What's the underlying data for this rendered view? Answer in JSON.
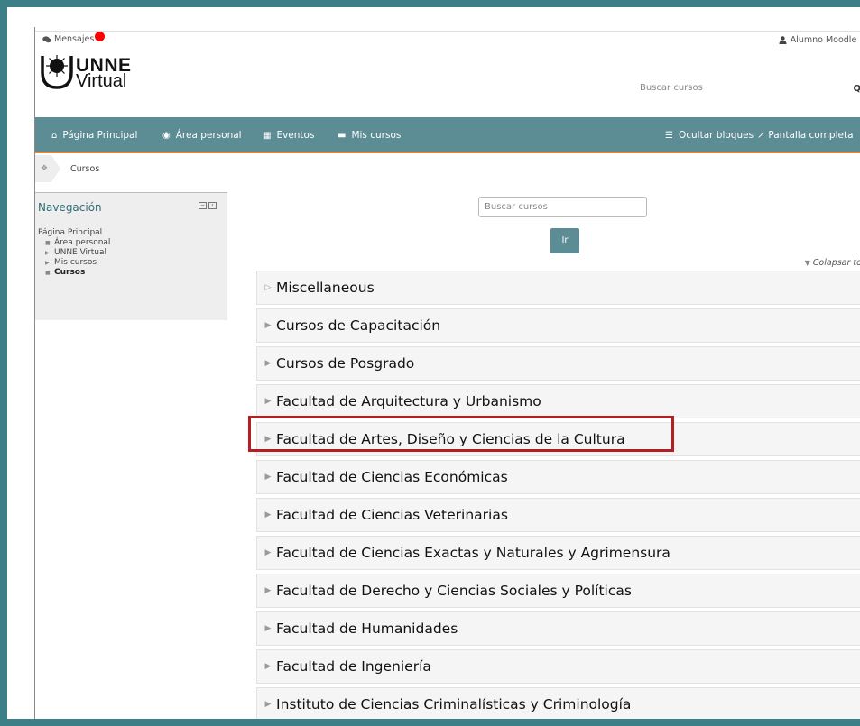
{
  "topbar": {
    "messages_label": "Mensajes",
    "user_label": "Alumno Moodle"
  },
  "logo": {
    "line1": "UNNE",
    "line2": "Virtual"
  },
  "top_search": {
    "placeholder": "Buscar cursos",
    "icon": "search-icon"
  },
  "navbar": {
    "items": [
      {
        "label": "Página Principal",
        "icon": "home-icon"
      },
      {
        "label": "Área personal",
        "icon": "dashboard-icon"
      },
      {
        "label": "Eventos",
        "icon": "calendar-icon"
      },
      {
        "label": "Mis cursos",
        "icon": "briefcase-icon"
      }
    ],
    "hide_blocks": "Ocultar bloques",
    "fullscreen": "Pantalla completa"
  },
  "breadcrumb": {
    "current": "Cursos"
  },
  "nav_block": {
    "title": "Navegación",
    "items": [
      {
        "label": "Página Principal"
      },
      {
        "label": "Área personal"
      },
      {
        "label": "UNNE Virtual"
      },
      {
        "label": "Mis cursos"
      },
      {
        "label": "Cursos"
      }
    ]
  },
  "main": {
    "search_placeholder": "Buscar cursos",
    "go_label": "Ir",
    "collapse_label": "Colapsar tod",
    "categories": [
      "Miscellaneous",
      "Cursos de Capacitación",
      "Cursos de Posgrado",
      "Facultad de Arquitectura y Urbanismo",
      "Facultad de Artes, Diseño y Ciencias de la Cultura",
      "Facultad de Ciencias Económicas",
      "Facultad de Ciencias Veterinarias",
      "Facultad de Ciencias Exactas y Naturales y Agrimensura",
      "Facultad de Derecho y Ciencias Sociales y Políticas",
      "Facultad de Humanidades",
      "Facultad de Ingeniería",
      "Instituto de Ciencias Criminalísticas y Criminología"
    ]
  },
  "colors": {
    "frame": "#3d7f86",
    "navbar": "#5c8c94",
    "accent_line": "#e6883a",
    "highlight": "#b41f24",
    "notification": "#ff0000"
  }
}
